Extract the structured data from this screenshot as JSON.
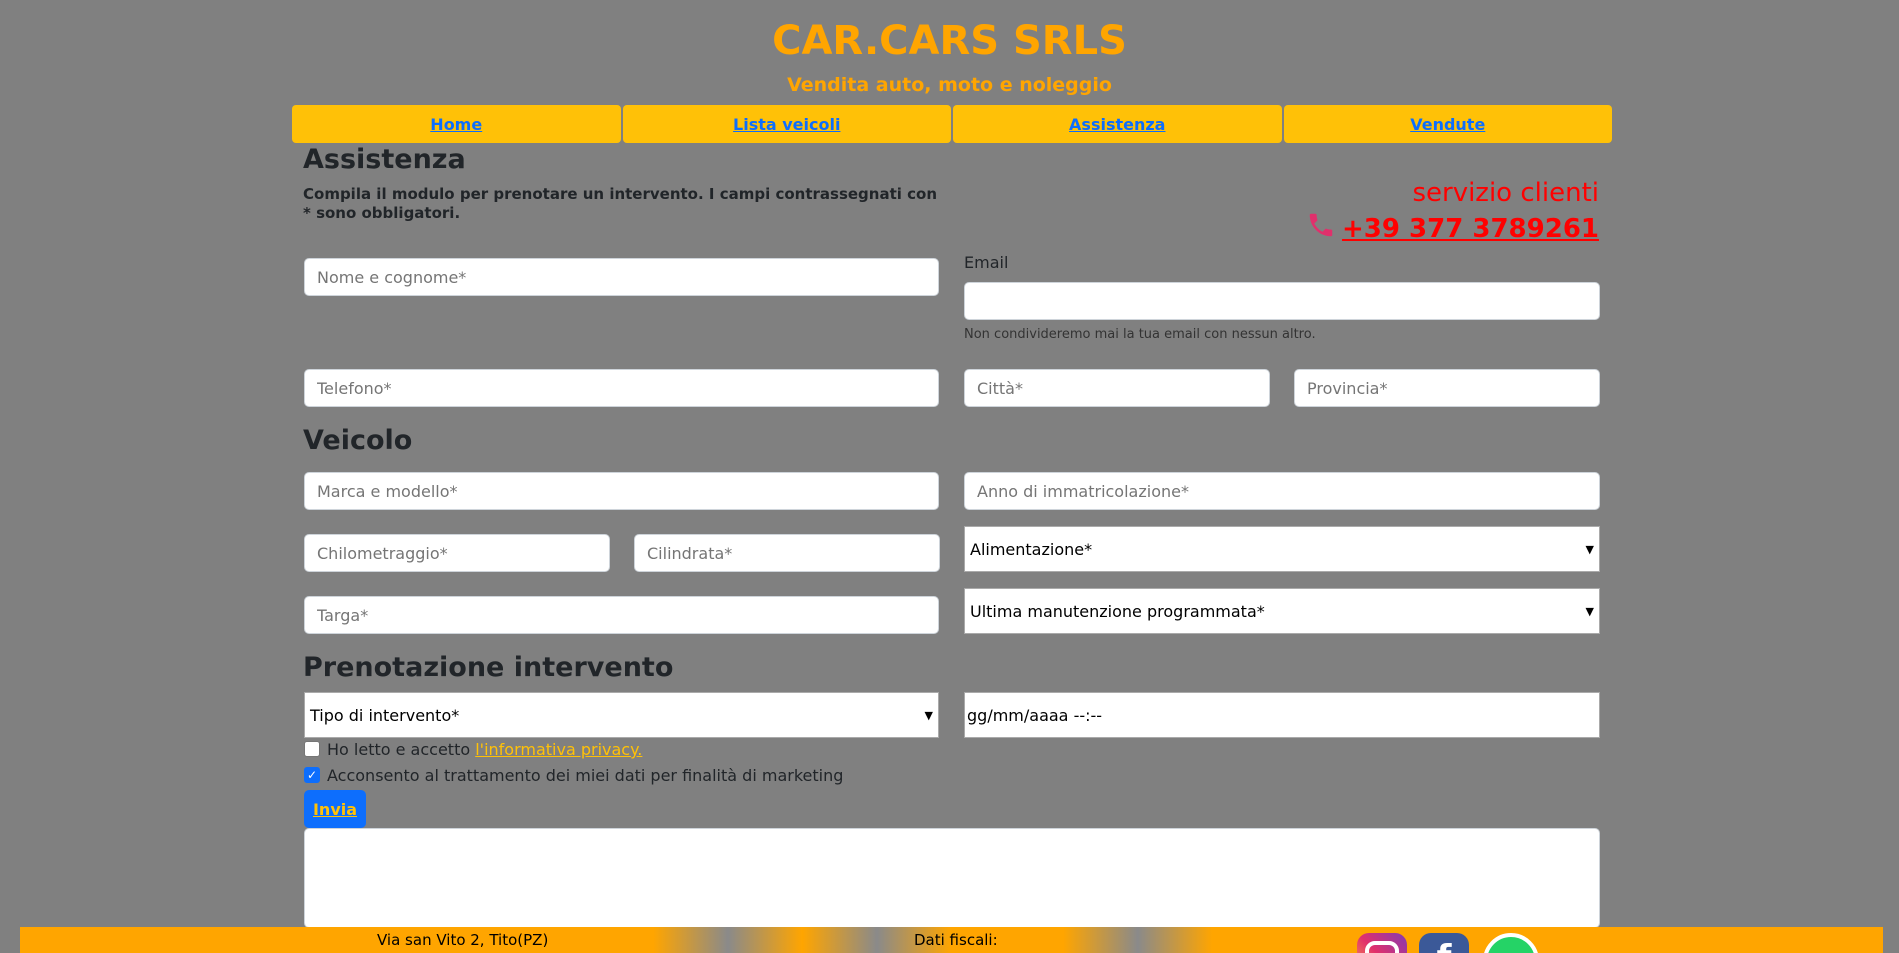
{
  "brand": {
    "title": "CAR.CARS SRLS",
    "subtitle": "Vendita auto, moto e noleggio"
  },
  "nav": {
    "items": [
      "Home",
      "Lista veicoli",
      "Assistenza",
      "Vendute"
    ]
  },
  "page": {
    "title": "Assistenza",
    "intro": "Compila il modulo per prenotare un intervento. I campi contrassegnati con * sono obbligatori."
  },
  "service": {
    "label": "servizio clienti",
    "phone": "+39 377 3789261",
    "icon": "phone-icon"
  },
  "customer": {
    "name_placeholder": "Nome e cognome*",
    "email_label": "Email",
    "email_value": "",
    "email_help": "Non condivideremo mai la tua email con nessun altro.",
    "phone_placeholder": "Telefono*",
    "city_placeholder": "Città*",
    "province_placeholder": "Provincia*"
  },
  "vehicle": {
    "title": "Veicolo",
    "make_model_placeholder": "Marca e modello*",
    "year_placeholder": "Anno di immatricolazione*",
    "mileage_placeholder": "Chilometraggio*",
    "displacement_placeholder": "Cilindrata*",
    "fuel_select": "Alimentazione*",
    "plate_placeholder": "Targa*",
    "maintenance_select": "Ultima manutenzione programmata*"
  },
  "booking": {
    "title": "Prenotazione intervento",
    "type_select": "Tipo di intervento*",
    "datetime_value": "gg/mm/aaaa --:--",
    "privacy_text": "Ho letto e accetto",
    "privacy_link": "l'informativa privacy.",
    "privacy_checked": false,
    "marketing_text": "Acconsento al trattamento dei miei dati per finalità di marketing",
    "marketing_checked": true,
    "submit_label": "Invia",
    "message_value": ""
  },
  "footer": {
    "address": "Via san Vito 2, Tito(PZ)",
    "tax_label": "Dati fiscali:",
    "social": [
      "instagram-icon",
      "facebook-icon",
      "whatsapp-icon"
    ]
  },
  "colors": {
    "background": "#808080",
    "brand": "#ffa500",
    "nav": "#ffc107",
    "accent": "#0d6efd",
    "service": "#ff0000"
  }
}
